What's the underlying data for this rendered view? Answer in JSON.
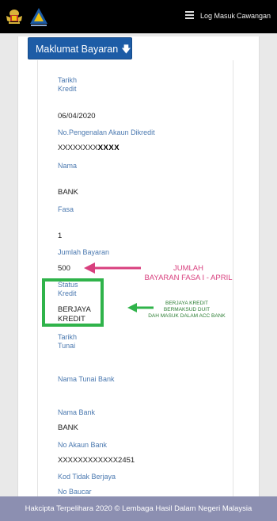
{
  "header": {
    "nav_login": "Log Masuk",
    "nav_branch": "Cawangan"
  },
  "section": {
    "title": "Maklumat Bayaran"
  },
  "fields": {
    "tarikh_kredit_label_1": "Tarikh",
    "tarikh_kredit_label_2": "Kredit",
    "tarikh_kredit_value": "06/04/2020",
    "akaun_label": "No.Pengenalan Akaun Dikredit",
    "akaun_value_prefix": "XXXXXXXX",
    "akaun_value_bold": "XXXX",
    "nama_label": "Nama",
    "nama_value": "BANK",
    "fasa_label": "Fasa",
    "fasa_value": "1",
    "jumlah_label": "Jumlah Bayaran",
    "jumlah_value": "500",
    "status_label_1": "Status",
    "status_label_2": "Kredit",
    "status_value_1": "BERJAYA",
    "status_value_2": "KREDIT",
    "tarikh_tunai_label_1": "Tarikh",
    "tarikh_tunai_label_2": "Tunai",
    "nama_tunai_label": "Nama Tunai Bank",
    "nama_bank_label": "Nama Bank",
    "nama_bank_value": "BANK",
    "no_akaun_label": "No Akaun Bank",
    "no_akaun_value": "XXXXXXXXXXXX2451",
    "kod_label": "Kod Tidak Berjaya",
    "baucar_label": "No Baucar"
  },
  "annotations": {
    "pink_line1": "JUMLAH",
    "pink_line2": "BAYARAN FASA I - APRIL",
    "green_line1": "BERJAYA KREDIT",
    "green_line2": "BERMAKSUD DUIT",
    "green_line3": "DAH MASUK DALAM ACC BANK"
  },
  "footer": {
    "text": "Hakcipta Terpelihara 2020 © Lembaga Hasil Dalam Negeri Malaysia"
  },
  "colors": {
    "header_bg": "#000000",
    "button_bg": "#1d5ca6",
    "label_blue": "#4b79b0",
    "annotation_pink": "#d83f7e",
    "annotation_green": "#2fb34a",
    "footer_bg": "#8c8fb1"
  },
  "icons": [
    "malaysia-crest-icon",
    "lhdn-logo-icon",
    "hamburger-menu-icon",
    "arrow-down-icon"
  ]
}
